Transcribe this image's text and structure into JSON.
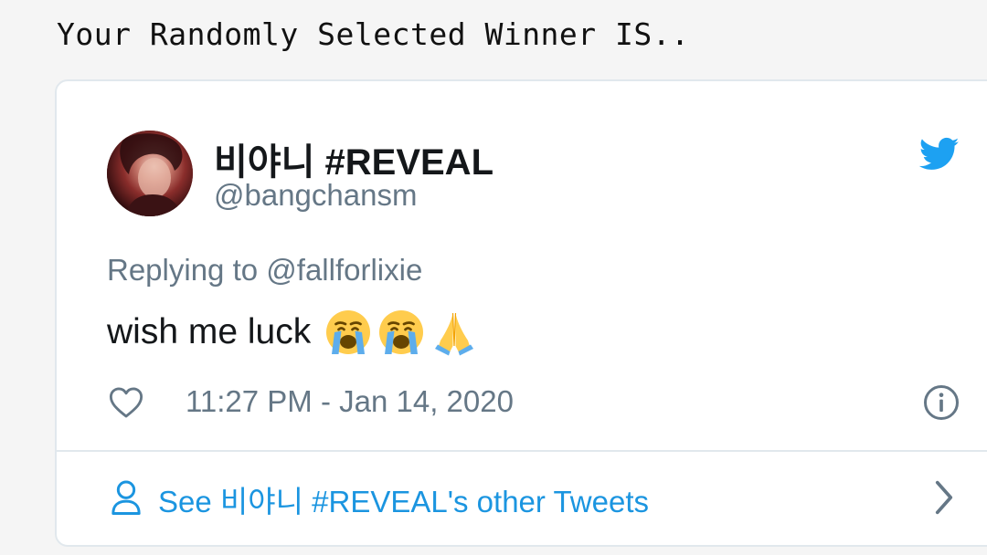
{
  "page": {
    "heading": "Your Randomly Selected Winner IS.."
  },
  "tweet": {
    "display_name": "비야니 #REVEAL",
    "handle": "@bangchansm",
    "replying_prefix": "Replying to",
    "replying_to": "@fallforlixie",
    "text": "wish me luck",
    "emojis": [
      "loudly-crying-face",
      "loudly-crying-face",
      "folded-hands"
    ],
    "timestamp": "11:27 PM - Jan 14, 2020",
    "footer_link": "See 비야니 #REVEAL's other Tweets"
  },
  "colors": {
    "link": "#1b95e0",
    "twitter_blue": "#1da1f2",
    "secondary_text": "#657786",
    "border": "#e1e8ed",
    "page_bg": "#f5f5f5"
  },
  "icons": {
    "brand": "twitter-bird-icon",
    "like": "heart-icon",
    "info": "info-icon",
    "profile": "person-icon",
    "more": "chevron-right-icon"
  }
}
